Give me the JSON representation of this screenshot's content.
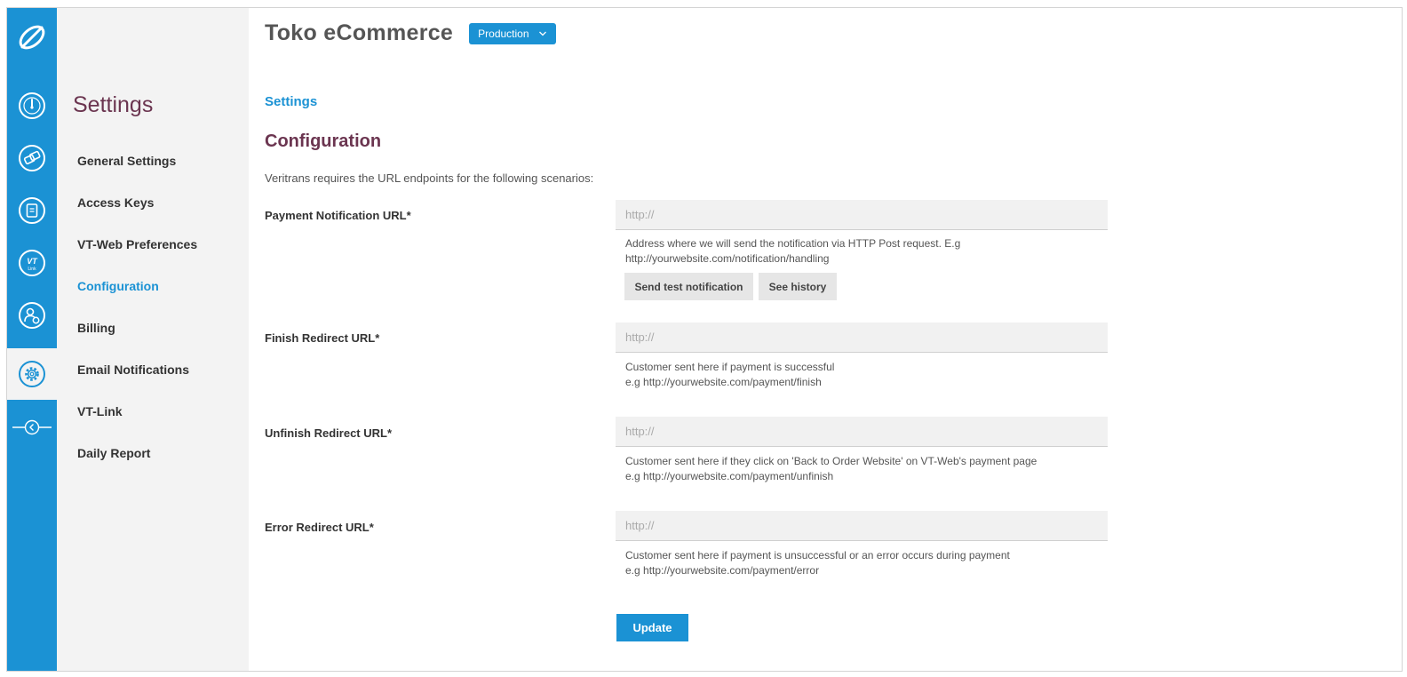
{
  "colors": {
    "rail": "#1b92d4",
    "accent": "#1b92d4",
    "heading": "#6b3550",
    "sidebar_bg": "#f3f3f3",
    "input_bg": "#f1f1f1"
  },
  "rail": {
    "logo_icon": "brand-swoosh-icon",
    "items": [
      {
        "icon": "dashboard-gauge-icon"
      },
      {
        "icon": "transactions-icon"
      },
      {
        "icon": "reports-icon"
      },
      {
        "icon": "vt-link-icon",
        "text": "VT",
        "sub": "Link"
      },
      {
        "icon": "user-management-icon"
      },
      {
        "icon": "settings-gear-icon",
        "active": true
      }
    ],
    "collapse_icon": "collapse-chevron-left-icon"
  },
  "sidebar": {
    "title": "Settings",
    "items": [
      {
        "label": "General Settings",
        "active": false
      },
      {
        "label": "Access Keys",
        "active": false
      },
      {
        "label": "VT-Web Preferences",
        "active": false
      },
      {
        "label": "Configuration",
        "active": true
      },
      {
        "label": "Billing",
        "active": false
      },
      {
        "label": "Email Notifications",
        "active": false
      },
      {
        "label": "VT-Link",
        "active": false
      },
      {
        "label": "Daily Report",
        "active": false
      }
    ]
  },
  "header": {
    "app_title": "Toko eCommerce",
    "environment": "Production"
  },
  "breadcrumb": "Settings",
  "section_title": "Configuration",
  "intro": "Veritrans requires the URL endpoints for the following scenarios:",
  "fields": {
    "payment_notification": {
      "label": "Payment Notification URL*",
      "placeholder": "http://",
      "help_line1": "Address where we will send the notification via HTTP Post request. E.g",
      "help_line2": "http://yourwebsite.com/notification/handling",
      "send_test_label": "Send test notification",
      "see_history_label": "See history"
    },
    "finish_redirect": {
      "label": "Finish Redirect URL*",
      "placeholder": "http://",
      "help_line1": "Customer sent here if payment is successful",
      "help_line2": "e.g http://yourwebsite.com/payment/finish"
    },
    "unfinish_redirect": {
      "label": "Unfinish Redirect URL*",
      "placeholder": "http://",
      "help_line1": "Customer sent here if they click on 'Back to Order Website' on VT-Web's payment page",
      "help_line2": "e.g http://yourwebsite.com/payment/unfinish"
    },
    "error_redirect": {
      "label": "Error Redirect URL*",
      "placeholder": "http://",
      "help_line1": "Customer sent here if payment is unsuccessful or an error occurs during payment",
      "help_line2": "e.g http://yourwebsite.com/payment/error"
    }
  },
  "update_label": "Update"
}
